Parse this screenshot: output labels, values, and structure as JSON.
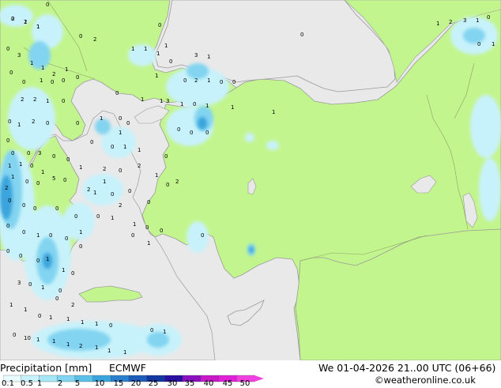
{
  "footer": {
    "title": "Precipitation [mm]",
    "model": "ECMWF",
    "datetime": "We 01-04-2026 21..00 UTC (06+66)",
    "credit": "©weatheronline.co.uk"
  },
  "colorbar": {
    "labels": [
      "0.1",
      "0.5",
      "1",
      "2",
      "5",
      "10",
      "15",
      "20",
      "25",
      "30",
      "35",
      "40",
      "45",
      "50"
    ],
    "colors": [
      "#e8fbff",
      "#c8f2fb",
      "#a6e6f6",
      "#82d4f0",
      "#5cbfe8",
      "#3aa4dc",
      "#2a80cc",
      "#1d5cb8",
      "#1238a0",
      "#2a10a0",
      "#8a10c0",
      "#c818c8",
      "#e020d8",
      "#f040e0"
    ]
  },
  "map_values": {
    "values": [
      "0",
      "1",
      "1",
      "0",
      "0",
      "2",
      "0",
      "1",
      "1",
      "1",
      "0",
      "0",
      "1",
      "0",
      "0",
      "0",
      "1",
      "3",
      "1",
      "0",
      "2",
      "1",
      "0",
      "0",
      "2",
      "2",
      "1",
      "0",
      "0",
      "1",
      "3",
      "1",
      "0",
      "1",
      "1",
      "1",
      "0",
      "1",
      "2",
      "0",
      "0",
      "1",
      "0",
      "0",
      "0",
      "0",
      "0",
      "0",
      "0",
      "1",
      "1",
      "0",
      "3",
      "0",
      "0",
      "1",
      "2",
      "0",
      "0",
      "2",
      "1",
      "0",
      "0",
      "0",
      "1",
      "0",
      "0",
      "0",
      "0",
      "0",
      "0",
      "0",
      "0",
      "0",
      "1",
      "1",
      "0",
      "0",
      "0",
      "1",
      "0",
      "0",
      "1",
      "0",
      "0",
      "0",
      "0",
      "0",
      "0",
      "1",
      "1",
      "0",
      "3",
      "0",
      "1",
      "0",
      "1",
      "1",
      "0",
      "1",
      "1",
      "1",
      "1",
      "0",
      "0",
      "10",
      "1",
      "1",
      "1",
      "2",
      "1",
      "1",
      "1",
      "0",
      "1",
      "1",
      "2",
      "3",
      "1",
      "0",
      "0",
      "1",
      "0",
      "3",
      "1",
      "1",
      "2",
      "1",
      "1",
      "0",
      "0",
      "1",
      "1",
      "2",
      "1",
      "0",
      "0",
      "1",
      "0",
      "0",
      "2",
      "1",
      "2",
      "0",
      "2",
      "2",
      "1",
      "1",
      "0",
      "1",
      "5",
      "6",
      "4",
      "2",
      "2",
      "1"
    ]
  },
  "colors": {
    "sea": "#e9e9e9",
    "land_dry": "#f0f0f0",
    "land_rain": "#c3f58e",
    "coast": "#9a9a9a",
    "border": "#8aa066"
  }
}
